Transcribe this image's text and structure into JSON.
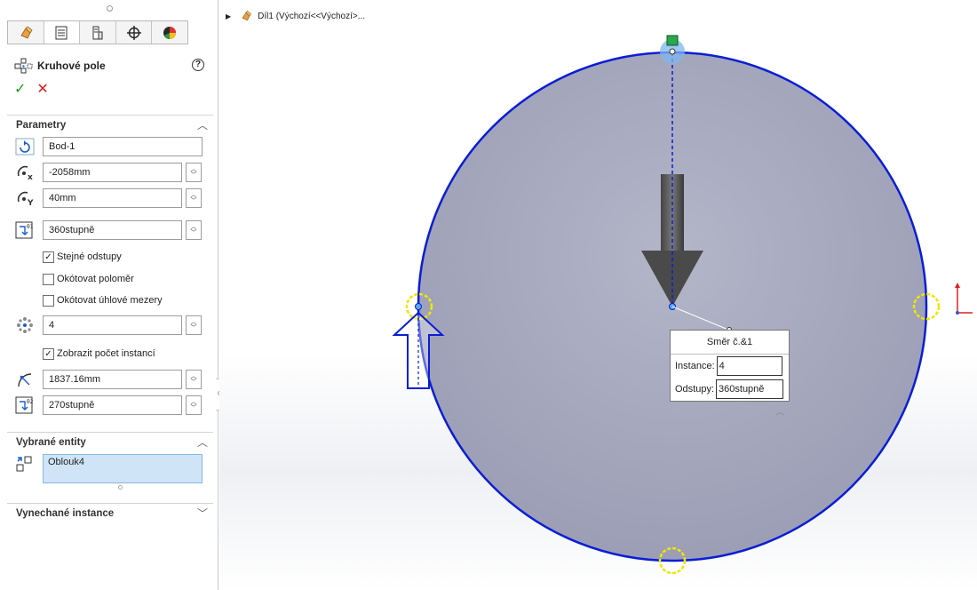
{
  "feature_tree": {
    "part_name": "Díl1  (Výchozí<<Výchozí>..."
  },
  "panel": {
    "title": "Kruhové pole",
    "help": "?",
    "ok": "✓",
    "cancel": "✕",
    "tabs": [
      "feature-manager-icon",
      "property-manager-icon",
      "configuration-manager-icon",
      "dimxpert-icon",
      "display-manager-icon"
    ],
    "parameters": {
      "header": "Parametry",
      "center_point": "Bod-1",
      "center_x": "-2058mm",
      "center_y": "40mm",
      "angle": "360stupně",
      "equal_spacing": "Stejné odstupy",
      "dim_radius": "Okótovat poloměr",
      "dim_angular": "Okótovat úhlové mezery",
      "instances": "4",
      "show_count": "Zobrazit počet instancí",
      "radius": "1837.16mm",
      "arc_angle": "270stupně"
    },
    "selected_entities": {
      "header": "Vybrané entity",
      "value": "Oblouk4"
    },
    "skipped_instances": {
      "header": "Vynechané instance"
    }
  },
  "callout": {
    "title": "Směr č.&1",
    "instances_label": "Instance:",
    "instances_value": "4",
    "spacing_label": "Odstupy:",
    "spacing_value": "360stupně"
  },
  "colors": {
    "circle_fill": "#a8aac0",
    "circle_stroke": "#0a1ed6",
    "marker_yellow": "#f0e600",
    "ok_green": "#1c9a1c",
    "cancel_red": "#d42020"
  }
}
